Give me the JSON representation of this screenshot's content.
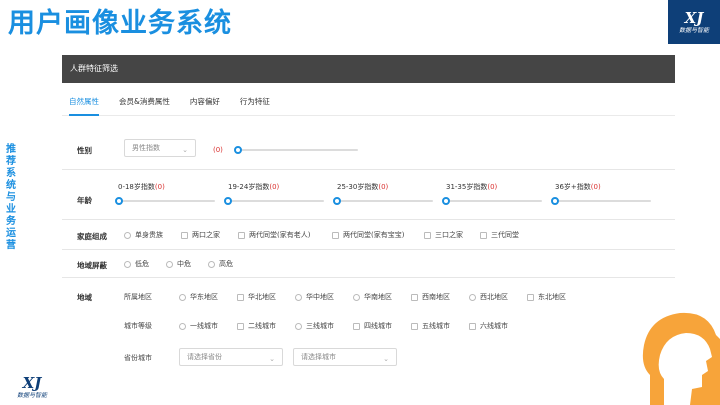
{
  "slide": {
    "title": "用户画像业务系统",
    "side_text": [
      "推",
      "荐",
      "系",
      "统",
      "与",
      "业",
      "务",
      "运",
      "营"
    ],
    "logo_mark": "XJ",
    "logo_caption": "数据与智能"
  },
  "panel": {
    "header": "人群特征筛选",
    "tabs": [
      "自然属性",
      "会员&消费属性",
      "内容偏好",
      "行为特征"
    ],
    "active_tab": 0
  },
  "gender": {
    "label": "性别",
    "select_value": "男性指数",
    "value": "(0)",
    "slider_level": 0
  },
  "age": {
    "label": "年龄",
    "groups": [
      {
        "name": "0-18岁指数",
        "value": "(0)",
        "level": 0
      },
      {
        "name": "19-24岁指数",
        "value": "(0)",
        "level": 0
      },
      {
        "name": "25-30岁指数",
        "value": "(0)",
        "level": 0
      },
      {
        "name": "31-35岁指数",
        "value": "(0)",
        "level": 0
      },
      {
        "name": "36岁+指数",
        "value": "(0)",
        "level": 0
      }
    ]
  },
  "family": {
    "label": "家庭组成",
    "options": [
      "单身贵族",
      "两口之家",
      "两代同堂(家有老人)",
      "两代同堂(家有宝宝)",
      "三口之家",
      "三代同堂"
    ]
  },
  "shield": {
    "label": "地域屏蔽",
    "options": [
      "低危",
      "中危",
      "高危"
    ]
  },
  "region": {
    "label": "地域",
    "area_label": "所属地区",
    "areas": [
      "华东地区",
      "华北地区",
      "华中地区",
      "华南地区",
      "西南地区",
      "西北地区",
      "东北地区"
    ],
    "level_label": "城市等级",
    "levels": [
      "一线城市",
      "二线城市",
      "三线城市",
      "四线城市",
      "五线城市",
      "六线城市"
    ],
    "province_label": "省份城市",
    "province_placeholder": "请选择省份",
    "city_placeholder": "请选择城市"
  },
  "colors": {
    "accent": "#1a8fe0",
    "header": "#454545",
    "warn": "#d9302f"
  }
}
